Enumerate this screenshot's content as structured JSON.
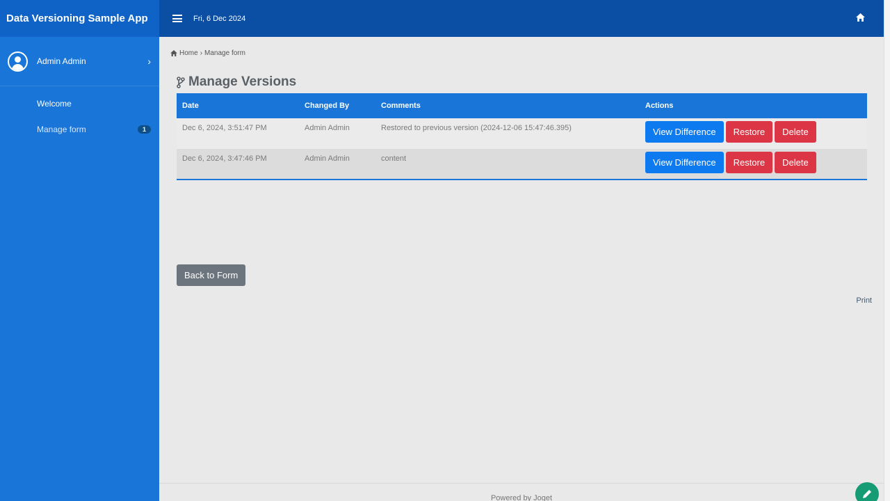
{
  "app": {
    "title": "Data Versioning Sample App"
  },
  "user": {
    "name": "Admin Admin"
  },
  "sidebar": {
    "items": [
      {
        "label": "Welcome"
      },
      {
        "label": "Manage form",
        "badge": "1"
      }
    ]
  },
  "topbar": {
    "date": "Fri, 6 Dec 2024"
  },
  "breadcrumb": {
    "home": "Home",
    "separator": "›",
    "current": "Manage form"
  },
  "page": {
    "title": "Manage Versions"
  },
  "table": {
    "headers": [
      "Date",
      "Changed By",
      "Comments",
      "Actions"
    ],
    "rows": [
      {
        "date": "Dec 6, 2024, 3:51:47 PM",
        "changed_by": "Admin Admin",
        "comments": "Restored to previous version (2024-12-06 15:47:46.395)"
      },
      {
        "date": "Dec 6, 2024, 3:47:46 PM",
        "changed_by": "Admin Admin",
        "comments": "content"
      }
    ],
    "actions": {
      "view_difference": "View Difference",
      "restore": "Restore",
      "delete": "Delete"
    }
  },
  "back_button": "Back to Form",
  "print_link": "Print",
  "footer": "Powered by Joget",
  "colors": {
    "sidebar": "#1976d8",
    "topbar": "#0b4fa5",
    "primary_button": "#0d7bef",
    "danger_button": "#dc3545",
    "secondary_button": "#6c757d",
    "fab": "#169c74"
  },
  "icons": {
    "menu": "hamburger-icon",
    "home": "home-icon",
    "user": "user-circle-icon",
    "branch": "code-branch-icon",
    "edit": "pencil-icon"
  }
}
